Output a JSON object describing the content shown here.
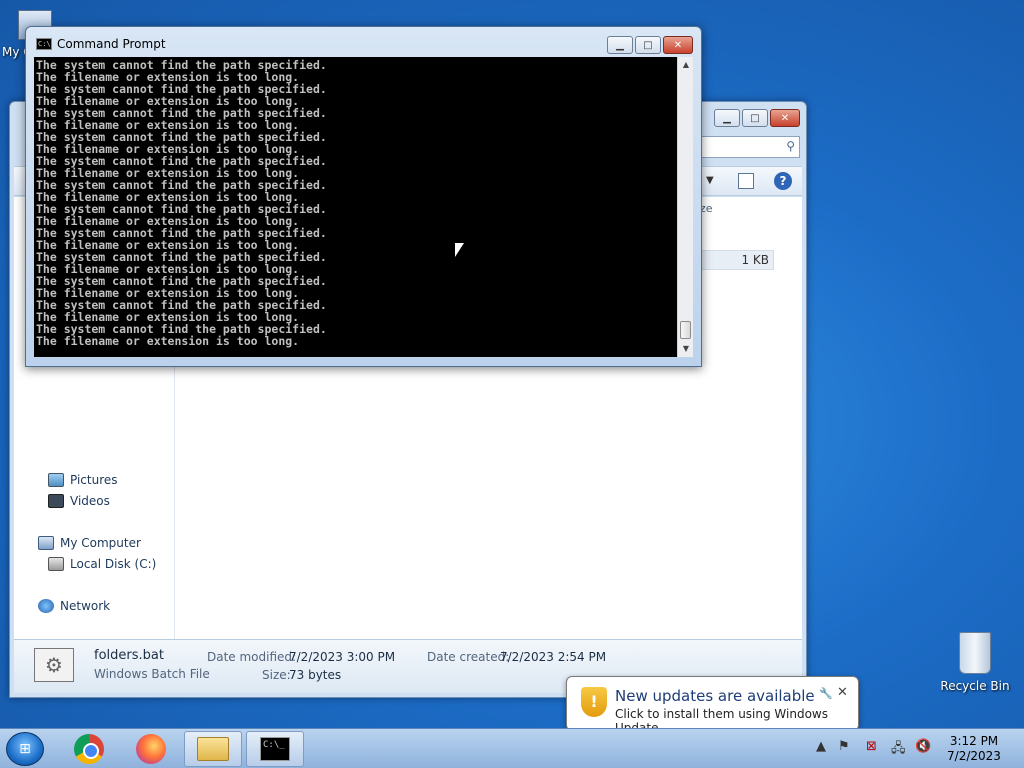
{
  "desktop": {
    "my_computer_label": "My C",
    "recycle_bin_label": "Recycle Bin"
  },
  "cmd": {
    "title": "Command Prompt",
    "lines": [
      "The system cannot find the path specified.",
      "The filename or extension is too long.",
      "The system cannot find the path specified.",
      "The filename or extension is too long.",
      "The system cannot find the path specified.",
      "The filename or extension is too long.",
      "The system cannot find the path specified.",
      "The filename or extension is too long.",
      "The system cannot find the path specified.",
      "The filename or extension is too long.",
      "The system cannot find the path specified.",
      "The filename or extension is too long.",
      "The system cannot find the path specified.",
      "The filename or extension is too long.",
      "The system cannot find the path specified.",
      "The filename or extension is too long.",
      "The system cannot find the path specified.",
      "The filename or extension is too long.",
      "The system cannot find the path specified.",
      "The filename or extension is too long.",
      "The system cannot find the path specified.",
      "The filename or extension is too long.",
      "The system cannot find the path specified.",
      "The filename or extension is too long."
    ]
  },
  "explorer": {
    "column_size_header": "ze",
    "file_size": "1 KB",
    "nav": {
      "pictures": "Pictures",
      "videos": "Videos",
      "my_computer": "My Computer",
      "local_disk": "Local Disk (C:)",
      "network": "Network"
    },
    "details": {
      "file_name": "folders.bat",
      "file_type": "Windows Batch File",
      "date_modified_label": "Date modified:",
      "date_modified": "7/2/2023 3:00 PM",
      "date_created_label": "Date created:",
      "date_created": "7/2/2023 2:54 PM",
      "size_label": "Size:",
      "size": "73 bytes"
    }
  },
  "notification": {
    "title": "New updates are available",
    "text": "Click to install them using Windows Update."
  },
  "taskbar": {
    "time": "3:12 PM",
    "date": "7/2/2023",
    "cmd_icon_text": "C:\\_"
  },
  "icons": {
    "start": "windows-orb",
    "chrome": "chrome-icon",
    "firefox": "firefox-icon",
    "explorer": "folder-icon",
    "cmd": "cmd-icon"
  }
}
